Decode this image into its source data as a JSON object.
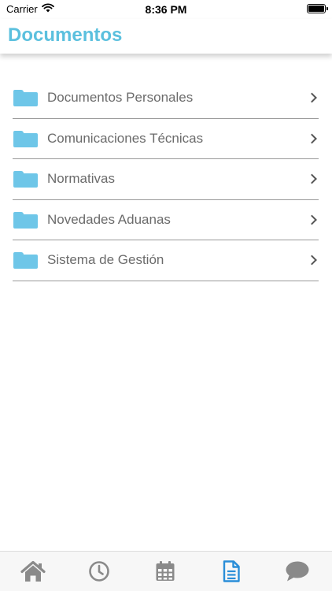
{
  "status_bar": {
    "carrier": "Carrier",
    "time": "8:36 PM"
  },
  "header": {
    "title": "Documentos"
  },
  "documents": [
    {
      "label": "Documentos Personales",
      "icon": "folder-icon"
    },
    {
      "label": "Comunicaciones Técnicas",
      "icon": "folder-icon"
    },
    {
      "label": "Normativas",
      "icon": "folder-icon"
    },
    {
      "label": "Novedades Aduanas",
      "icon": "folder-icon"
    },
    {
      "label": "Sistema de Gestión",
      "icon": "folder-icon"
    }
  ],
  "tab_bar": {
    "tabs": [
      {
        "icon": "home-icon",
        "active": false
      },
      {
        "icon": "clock-icon",
        "active": false
      },
      {
        "icon": "calendar-icon",
        "active": false
      },
      {
        "icon": "document-icon",
        "active": true
      },
      {
        "icon": "chat-bubble-icon",
        "active": false
      }
    ]
  },
  "colors": {
    "accent": "#5bc0de",
    "folder": "#6ec6e8",
    "tab_active": "#2a8ed8",
    "tab_inactive": "#8a8a8a",
    "label_text": "#6b6b6b"
  }
}
